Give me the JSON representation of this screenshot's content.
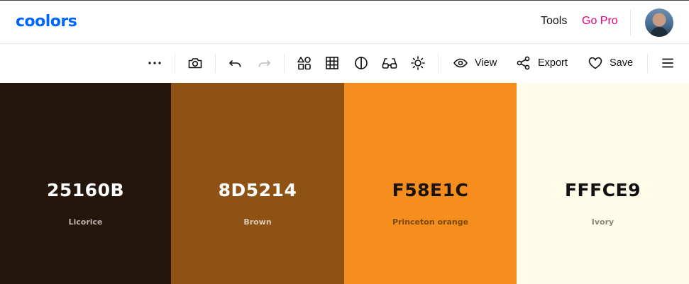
{
  "header": {
    "logo": "coolors",
    "tools_label": "Tools",
    "gopro_label": "Go Pro",
    "gopro_color": "#e5007e",
    "brand_color": "#0066ff"
  },
  "toolbar": {
    "more_icon": "more-horizontal-icon",
    "camera_icon": "camera-icon",
    "undo_icon": "undo-icon",
    "redo_icon": "redo-icon",
    "shapes_icon": "shapes-icon",
    "grid_icon": "grid-icon",
    "contrast_icon": "contrast-icon",
    "glasses_icon": "glasses-icon",
    "brightness_icon": "sun-icon",
    "view_label": "View",
    "export_label": "Export",
    "save_label": "Save",
    "menu_icon": "hamburger-menu-icon"
  },
  "palette": {
    "colors": [
      {
        "hex": "25160B",
        "name": "Licorice",
        "bg": "#25160B",
        "text": "#ffffff",
        "name_color": "#b9b2ad"
      },
      {
        "hex": "8D5214",
        "name": "Brown",
        "bg": "#8D5214",
        "text": "#ffffff",
        "name_color": "#dcc9b5"
      },
      {
        "hex": "F58E1C",
        "name": "Princeton orange",
        "bg": "#F58E1C",
        "text": "#1a1208",
        "name_color": "#7a4a10"
      },
      {
        "hex": "FFFCE9",
        "name": "Ivory",
        "bg": "#FFFCE9",
        "text": "#111111",
        "name_color": "#8a8779"
      }
    ]
  }
}
